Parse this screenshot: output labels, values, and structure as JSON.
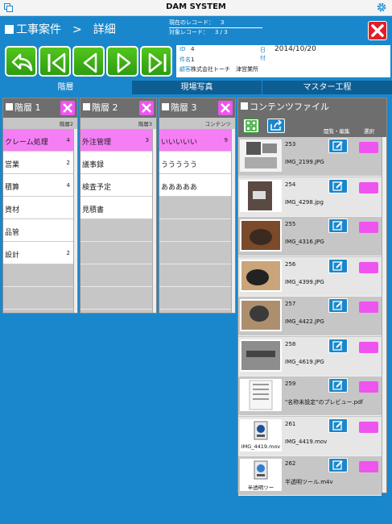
{
  "app": {
    "title": "DAM SYSTEM"
  },
  "header": {
    "title": "工事案件　>　詳細",
    "current_label": "現在のレコード：",
    "current_value": "3",
    "target_label": "対象レコード：",
    "target_value": "3 / 3"
  },
  "info": {
    "id_label": "ID",
    "id_value": "4",
    "date_label": "日付",
    "date_value": "2014/10/20",
    "name_label": "件名",
    "name_value": "1",
    "client_label": "顧客",
    "client_value": "株式会社トーチ　津営業所"
  },
  "tabs": [
    {
      "label": "階層"
    },
    {
      "label": "現場写真"
    },
    {
      "label": "マスター工程"
    }
  ],
  "colors": {
    "accent": "#1a87cc",
    "nav_green": "#3aaa14",
    "selected_pink": "#f57ef5",
    "close_red": "#e21f26"
  },
  "panel1": {
    "title": "階層 1",
    "sub": "階層2",
    "items": [
      {
        "label": "クレーム処理",
        "count": "4"
      },
      {
        "label": "営業",
        "count": "2"
      },
      {
        "label": "積算",
        "count": "4"
      },
      {
        "label": "資材",
        "count": ""
      },
      {
        "label": "品管",
        "count": ""
      },
      {
        "label": "設計",
        "count": "2"
      }
    ]
  },
  "panel2": {
    "title": "階層 2",
    "sub": "階層3",
    "items": [
      {
        "label": "外注管理",
        "count": "3"
      },
      {
        "label": "議事録",
        "count": ""
      },
      {
        "label": "検査予定",
        "count": ""
      },
      {
        "label": "見積書",
        "count": ""
      }
    ]
  },
  "panel3": {
    "title": "階層 3",
    "sub": "コンテンツ",
    "items": [
      {
        "label": "いいいいい",
        "count": "9"
      },
      {
        "label": "ううううう",
        "count": ""
      },
      {
        "label": "あああああ",
        "count": ""
      }
    ]
  },
  "content": {
    "title": "コンテンツファイル",
    "col_view": "閲覧・編集",
    "col_select": "選択",
    "items": [
      {
        "num": "253",
        "file": "IMG_2199.JPG",
        "caption": ""
      },
      {
        "num": "254",
        "file": "IMG_4298.jpg",
        "caption": ""
      },
      {
        "num": "255",
        "file": "IMG_4316.JPG",
        "caption": ""
      },
      {
        "num": "256",
        "file": "IMG_4399.JPG",
        "caption": ""
      },
      {
        "num": "257",
        "file": "IMG_4422.JPG",
        "caption": ""
      },
      {
        "num": "258",
        "file": "IMG_4619.JPG",
        "caption": ""
      },
      {
        "num": "259",
        "file": "\"名称未設定\"のプレビュー.pdf",
        "caption": ""
      },
      {
        "num": "261",
        "file": "IMG_4419.mov",
        "caption": "IMG_4419.mov"
      },
      {
        "num": "262",
        "file": "半透明ツール.m4v",
        "caption": "半透明ツー"
      }
    ]
  }
}
